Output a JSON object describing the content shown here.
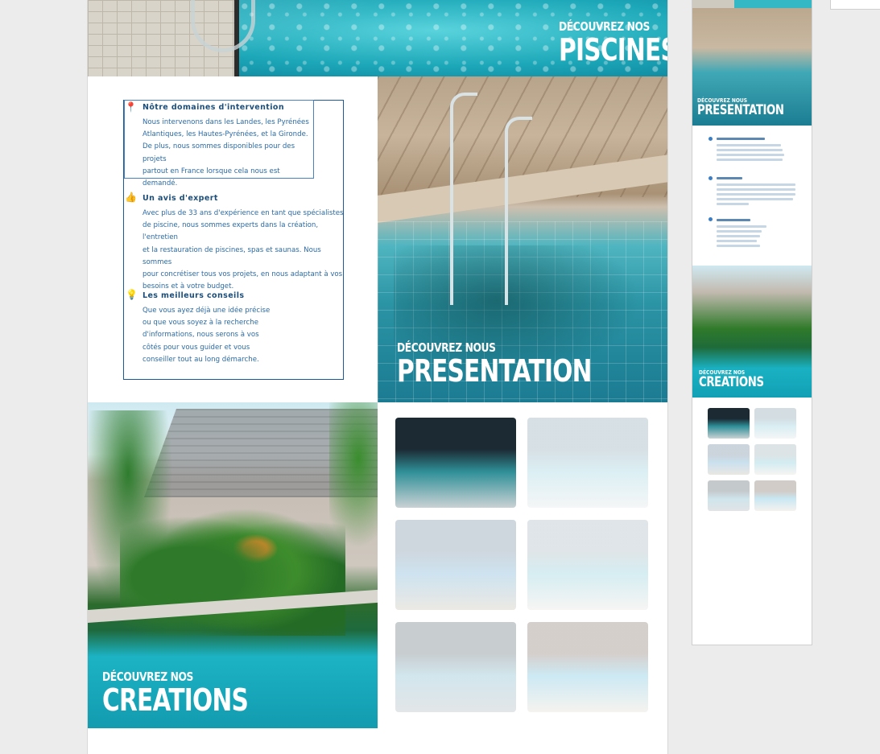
{
  "sections": {
    "piscines": {
      "kicker": "Découvrez nos",
      "title": "Piscines"
    },
    "presentation": {
      "kicker": "Découvrez nous",
      "title": "Presentation"
    },
    "creations": {
      "kicker": "Découvrez nos",
      "title": "Creations"
    }
  },
  "info": {
    "items": [
      {
        "icon": "map-pin-icon",
        "heading": "Nôtre domaines d'intervention",
        "lines": [
          "Nous intervenons dans les Landes, les Pyrénées",
          "Atlantiques, les Hautes-Pyrénées, et la Gironde.",
          "De plus, nous sommes disponibles pour des projets",
          "partout en France lorsque cela nous est demandé."
        ]
      },
      {
        "icon": "thumbs-up-icon",
        "heading": "Un avis d'expert",
        "lines": [
          "Avec plus de 33 ans d'expérience en tant que spécialistes",
          "de piscine, nous sommes experts dans la création, l'entretien",
          "et la restauration de piscines, spas et saunas. Nous sommes",
          "pour concrétiser tous vos projets, en nous adaptant à vos",
          "besoins et à votre budget."
        ]
      },
      {
        "icon": "lightbulb-icon",
        "heading": "Les meilleurs conseils",
        "lines": [
          "Que vous ayez déjà une idée précise",
          "ou que vous soyez à la recherche",
          "d'informations, nous serons à vos",
          "côtés pour vous guider et vous",
          "conseiller tout au long démarche."
        ]
      }
    ]
  },
  "gallery": {
    "thumbs": [
      {
        "name": "gallery-thumb-indoor-spa",
        "faded": false,
        "colors": [
          "#1c2a33",
          "#2f8f98",
          "#c9d2d4"
        ]
      },
      {
        "name": "gallery-thumb-indoor-pool-1",
        "faded": true,
        "colors": [
          "#6f8fa0",
          "#7fc6d6",
          "#d9dfe2"
        ]
      },
      {
        "name": "gallery-thumb-house-pool",
        "faded": true,
        "colors": [
          "#53708a",
          "#4f9ac9",
          "#b8b09e"
        ]
      },
      {
        "name": "gallery-thumb-terrace-pool",
        "faded": true,
        "colors": [
          "#8da3ab",
          "#6bbfd1",
          "#e0dcd6"
        ]
      },
      {
        "name": "gallery-thumb-veranda-pool",
        "faded": true,
        "colors": [
          "#3b4d56",
          "#5ea8c0",
          "#9aa6ab"
        ]
      },
      {
        "name": "gallery-thumb-outdoor-pool",
        "faded": true,
        "colors": [
          "#6a5446",
          "#4cb1d6",
          "#dcd4c7"
        ]
      }
    ]
  },
  "overview": {
    "labels": {
      "presentation": {
        "kicker": "Découvrez nous",
        "title": "Presentation"
      },
      "creations": {
        "kicker": "Découvrez nos",
        "title": "Creations"
      }
    }
  }
}
